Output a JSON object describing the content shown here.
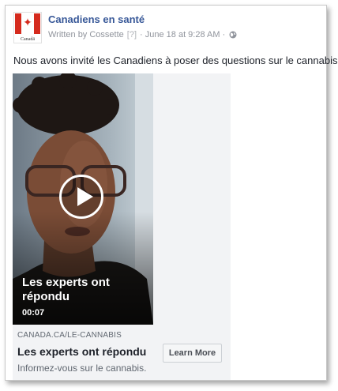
{
  "post": {
    "page_name": "Canadiens en santé",
    "avatar_label": "Canadä",
    "meta": {
      "written_by": "Written by Cossette",
      "help": "[?]",
      "separator": "·",
      "timestamp": "June 18 at 9:28 AM",
      "separator2": "·",
      "privacy_icon": "globe-icon"
    },
    "text": "Nous avons invité les Canadiens à poser des questions sur le cannabis."
  },
  "video": {
    "title": "Les experts ont répondu",
    "duration": "00:07",
    "play_icon": "play-icon"
  },
  "cta": {
    "domain": "CANADA.CA/LE-CANNABIS",
    "headline": "Les experts ont répondu",
    "description": "Informez-vous sur le cannabis.",
    "button_label": "Learn More"
  },
  "colors": {
    "page_name": "#385898",
    "meta": "#90949c",
    "flag_red": "#d52b1e",
    "cta_background": "#f2f3f5"
  }
}
